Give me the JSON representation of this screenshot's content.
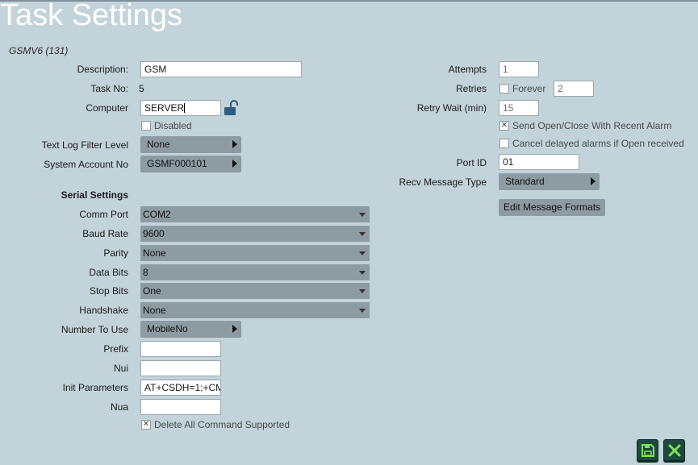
{
  "page": {
    "title": "Task Settings",
    "subtitle": "GSMV6 (131)"
  },
  "left": {
    "description": {
      "label": "Description:",
      "value": "GSM"
    },
    "task_no": {
      "label": "Task No:",
      "value": "5"
    },
    "computer": {
      "label": "Computer",
      "value": "SERVER"
    },
    "disabled": {
      "label": "Disabled",
      "checked": false
    },
    "text_log_filter": {
      "label": "Text Log Filter Level",
      "value": "None"
    },
    "system_account": {
      "label": "System Account No",
      "value": "GSMF000101"
    }
  },
  "serial": {
    "heading": "Serial Settings",
    "comm_port": {
      "label": "Comm Port",
      "value": "COM2"
    },
    "baud_rate": {
      "label": "Baud Rate",
      "value": "9600"
    },
    "parity": {
      "label": "Parity",
      "value": "None"
    },
    "data_bits": {
      "label": "Data Bits",
      "value": "8"
    },
    "stop_bits": {
      "label": "Stop Bits",
      "value": "One"
    },
    "handshake": {
      "label": "Handshake",
      "value": "None"
    },
    "number_to_use": {
      "label": "Number To Use",
      "value": "MobileNo"
    },
    "prefix": {
      "label": "Prefix",
      "value": ""
    },
    "nui": {
      "label": "Nui",
      "value": ""
    },
    "init_parameters": {
      "label": "Init Parameters",
      "value": "AT+CSDH=1;+CM"
    },
    "nua": {
      "label": "Nua",
      "value": ""
    },
    "delete_all": {
      "label": "Delete All Command Supported",
      "checked": true
    }
  },
  "right": {
    "attempts": {
      "label": "Attempts",
      "value": "1"
    },
    "retries": {
      "label": "Retries",
      "forever_label": "Forever",
      "forever_checked": false,
      "value": "2"
    },
    "retry_wait": {
      "label": "Retry Wait (min)",
      "value": "15"
    },
    "send_open_close": {
      "label": "Send Open/Close With Recent Alarm",
      "checked": true
    },
    "cancel_delayed": {
      "label": "Cancel delayed alarms if Open received",
      "checked": false
    },
    "port_id": {
      "label": "Port ID",
      "value": "01"
    },
    "recv_message_type": {
      "label": "Recv Message Type",
      "value": "Standard"
    },
    "edit_formats": {
      "label": "Edit Message Formats"
    }
  },
  "actions": {
    "save_icon": "floppy-disk-icon",
    "cancel_icon": "close-icon",
    "accent": "#1d4a3c",
    "icon_color": "#7fe05a"
  }
}
